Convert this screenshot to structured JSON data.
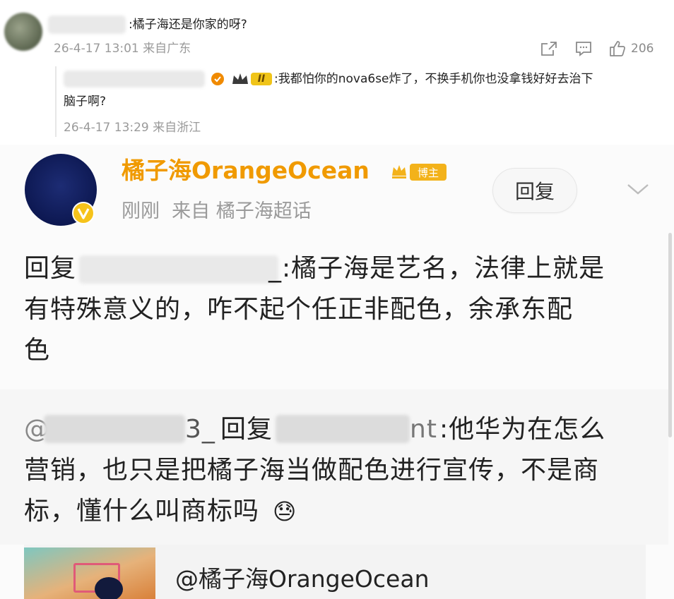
{
  "comment1": {
    "text": ":橘子海还是你家的呀?",
    "meta": "26-4-17 13:01 来自广东",
    "like_count": "206"
  },
  "reply1": {
    "level_badge": "II",
    "text_line1": ":我都怕你的nova6se炸了，不换手机你也没拿钱好好去治下",
    "text_line2": "脑子啊?",
    "meta": "26-4-17 13:29 来自浙江"
  },
  "post": {
    "author": "橘子海OrangeOcean",
    "author_badge": "博主",
    "meta": "刚刚  来自 橘子海超话",
    "reply_button": "回复",
    "body_prefix": "回复",
    "body_line1": "_:橘子海是艺名，法律上就是",
    "body_line2": "有特殊意义的，咋不起个任正非配色，余承东配",
    "body_line3": "色"
  },
  "quote": {
    "user_suffix": "3_",
    "reply_word": "回复",
    "target_suffix": "nt",
    "line1": ":他华为在怎么",
    "line2": "营销，也只是把橘子海当做配色进行宣传，不是商",
    "line3": "标，懂什么叫商标吗",
    "emoji": "😓"
  },
  "share_card": {
    "title": "@橘子海OrangeOcean"
  },
  "icons": {
    "share": "share-icon",
    "comment": "comment-icon",
    "like": "thumbs-up-icon",
    "dropdown": "chevron-down-icon",
    "verified": "verified-v-icon"
  },
  "colors": {
    "accent_orange": "#f0a000",
    "verified_yellow": "#f6c31b",
    "meta_gray": "#9a9a9a"
  }
}
